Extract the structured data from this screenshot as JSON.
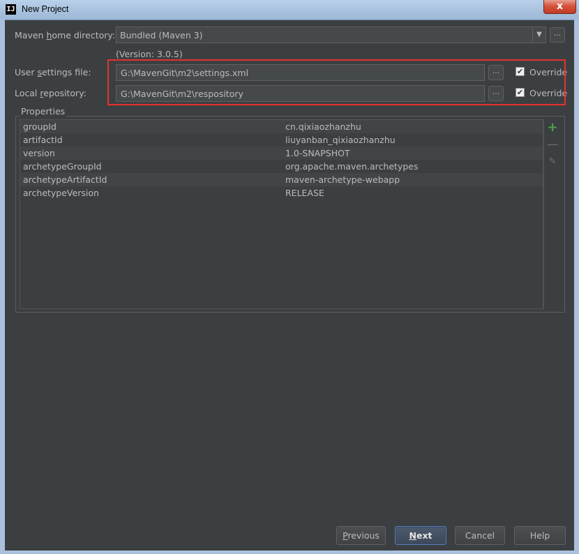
{
  "window": {
    "title": "New Project",
    "close_glyph": "x",
    "app_icon_text": "IJ",
    "app_icon": "intellij-icon"
  },
  "maven_home": {
    "label_pre": "Maven ",
    "label_u": "h",
    "label_post": "ome directory:",
    "value": "Bundled (Maven 3)",
    "version_note": "(Version: 3.0.5)"
  },
  "user_settings": {
    "label_pre": "User ",
    "label_u": "s",
    "label_post": "ettings file:",
    "value": "G:\\MavenGit\\m2\\settings.xml",
    "override_label": "Override",
    "override_checked": true
  },
  "local_repo": {
    "label_pre": "Local ",
    "label_u": "r",
    "label_post": "epository:",
    "value": "G:\\MavenGit\\m2\\respository",
    "override_label": "Override",
    "override_checked": true
  },
  "browse_glyph": "...",
  "properties": {
    "title": "Properties",
    "rows": [
      {
        "key": "groupId",
        "value": "cn.qixiaozhanzhu"
      },
      {
        "key": "artifactId",
        "value": "liuyanban_qixiaozhanzhu"
      },
      {
        "key": "version",
        "value": "1.0-SNAPSHOT"
      },
      {
        "key": "archetypeGroupId",
        "value": "org.apache.maven.archetypes"
      },
      {
        "key": "archetypeArtifactId",
        "value": "maven-archetype-webapp"
      },
      {
        "key": "archetypeVersion",
        "value": "RELEASE"
      }
    ],
    "tools": [
      "plus-icon",
      "minus-icon",
      "pencil-icon"
    ]
  },
  "buttons": {
    "previous": {
      "pre": "",
      "u": "P",
      "post": "revious"
    },
    "next": {
      "pre": "",
      "u": "N",
      "post": "ext"
    },
    "cancel": "Cancel",
    "help": "Help"
  },
  "colors": {
    "highlight": "#e5312c",
    "add": "#49a54a",
    "background": "#3c3f41"
  }
}
